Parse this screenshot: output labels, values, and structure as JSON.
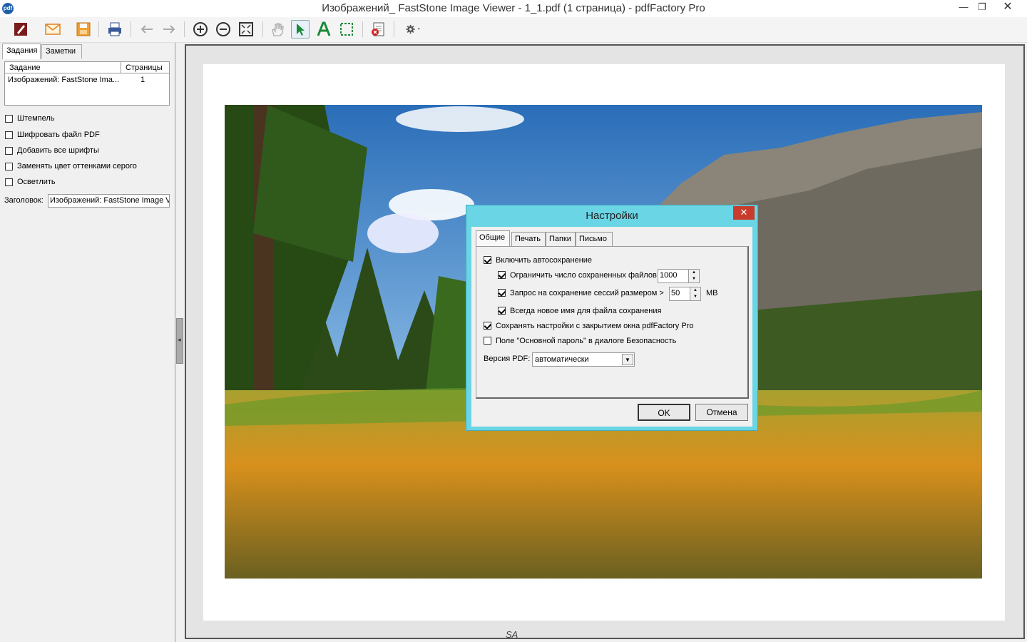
{
  "window": {
    "title": "Изображений_ FastStone Image Viewer - 1_1.pdf (1 страница) - pdfFactory Pro",
    "app_icon_text": "pdf",
    "minimize": "—",
    "maximize": "❐",
    "close": "✕"
  },
  "toolbar": {
    "items": [
      "edit-icon",
      "email-icon",
      "save-icon",
      "print-icon",
      "back-arrow-icon",
      "forward-arrow-icon",
      "zoom-in-icon",
      "zoom-out-icon",
      "fit-page-icon",
      "hand-tool-icon",
      "select-arrow-icon",
      "text-tool-icon",
      "marquee-select-icon",
      "delete-page-icon",
      "settings-gear-icon"
    ]
  },
  "left_panel": {
    "tabs": [
      "Задания",
      "Заметки"
    ],
    "job_list": {
      "columns": [
        "Задание",
        "Страницы"
      ],
      "rows": [
        {
          "job": "Изображений: FastStone Ima...",
          "pages": "1"
        }
      ]
    },
    "options": [
      {
        "label": "Штемпель",
        "checked": false
      },
      {
        "label": "Шифровать файл PDF",
        "checked": false
      },
      {
        "label": "Добавить все шрифты",
        "checked": false
      },
      {
        "label": "Заменять цвет оттенками серого",
        "checked": false
      },
      {
        "label": "Осветлить",
        "checked": false
      }
    ],
    "header_label": "Заголовок:",
    "header_value": "Изображений: FastStone Image V"
  },
  "viewer": {
    "footer_mark": "SA"
  },
  "dialog": {
    "title": "Настройки",
    "close": "✕",
    "tabs": [
      "Общие",
      "Печать",
      "Папки",
      "Письмо"
    ],
    "active_tab": "Общие",
    "autosave_label": "Включить автосохранение",
    "limit_label": "Ограничить число сохраненных файлов",
    "limit_value": "1000",
    "session_label": "Запрос на сохранение сессий размером >",
    "session_value": "50",
    "session_unit": "MB",
    "newname_label": "Всегда новое имя для файла сохранения",
    "keep_label": "Сохранять настройки с закрытием окна pdfFactory Pro",
    "password_label": "Поле \"Основной пароль\" в диалоге Безопасность",
    "version_label": "Версия PDF:",
    "version_value": "автоматически",
    "ok": "OK",
    "cancel": "Отмена"
  }
}
